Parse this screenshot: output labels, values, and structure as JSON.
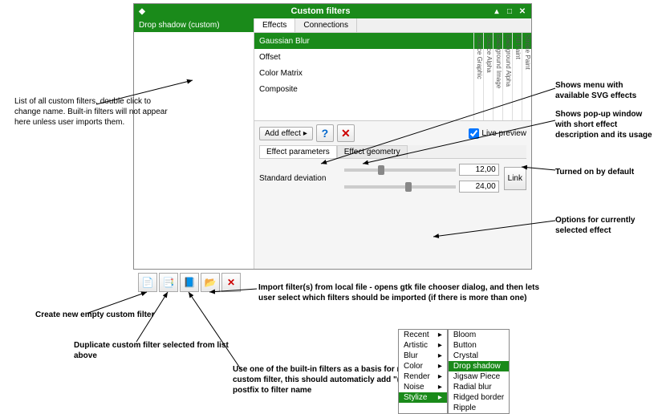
{
  "window": {
    "title": "Custom filters"
  },
  "sidebar": {
    "header": "Drop shadow (custom)"
  },
  "tabs": {
    "effects": "Effects",
    "connections": "Connections"
  },
  "effects": [
    "Gaussian Blur",
    "Offset",
    "Color Matrix",
    "Composite"
  ],
  "vlabels": [
    "Source Graphic",
    "Source Alpha",
    "Background Image",
    "Background Alpha",
    "Fill Paint",
    "Stroke Paint"
  ],
  "actions": {
    "add_effect": "Add effect",
    "live_preview": "Live preview"
  },
  "subtabs": {
    "params": "Effect parameters",
    "geom": "Effect geometry"
  },
  "params": {
    "std_dev": "Standard deviation",
    "v1": "12,00",
    "v2": "24,00",
    "link": "Link"
  },
  "toolbar_icons": [
    "new",
    "duplicate",
    "builtin",
    "import",
    "delete"
  ],
  "annotations": {
    "a1": "List of all custom filters, double click to change name. Built-in filters will not appear here unless user imports them.",
    "a2": "Shows menu with available SVG effects",
    "a3": "Shows pop-up window with short effect description and its usage",
    "a4": "Turned on by default",
    "a5": "Options for currently selected effect",
    "a6": "Import filter(s) from local file - opens gtk file chooser dialog, and then lets user select which filters should be imported (if there is more than one)",
    "a7": "Create new empty custom filter",
    "a8": "Duplicate custom filter selected from list above",
    "a9": "Use one of the built-in filters as a basis for new custom filter, this should automaticly add \"(custom)\" postfix to filter name"
  },
  "menu": {
    "left": [
      "Recent",
      "Artistic",
      "Blur",
      "Color",
      "Render",
      "Noise",
      "Stylize"
    ],
    "right": [
      "Bloom",
      "Button",
      "Crystal",
      "Drop shadow",
      "Jigsaw Piece",
      "Radial blur",
      "Ridged border",
      "Ripple"
    ]
  }
}
